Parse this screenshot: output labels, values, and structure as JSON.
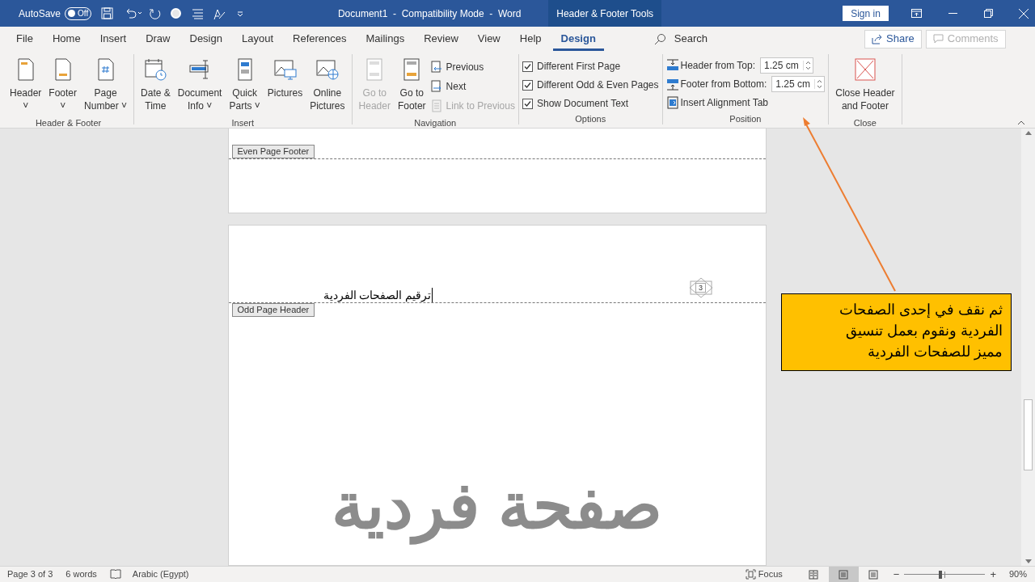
{
  "title_bar": {
    "autosave_label": "AutoSave",
    "autosave_on": false,
    "autosave_state": "Off",
    "document_title": "Document1  -  Compatibility Mode  -  Word",
    "contextual_tab": "Header & Footer Tools",
    "sign_in": "Sign in"
  },
  "menu_tabs": [
    {
      "label": "File",
      "selected": false
    },
    {
      "label": "Home",
      "selected": false
    },
    {
      "label": "Insert",
      "selected": false
    },
    {
      "label": "Draw",
      "selected": false
    },
    {
      "label": "Design",
      "selected": false
    },
    {
      "label": "Layout",
      "selected": false
    },
    {
      "label": "References",
      "selected": false
    },
    {
      "label": "Mailings",
      "selected": false
    },
    {
      "label": "Review",
      "selected": false
    },
    {
      "label": "View",
      "selected": false
    },
    {
      "label": "Help",
      "selected": false
    },
    {
      "label": "Design",
      "selected": true
    }
  ],
  "search": "Search",
  "share": "Share",
  "comments": {
    "label": "Comments",
    "disabled": true
  },
  "ribbon_groups": [
    {
      "name": "Header & Footer",
      "items": [
        {
          "kind": "big",
          "label": "Header\n˅",
          "disabled": false
        },
        {
          "kind": "big",
          "label": "Footer\n˅",
          "disabled": false
        },
        {
          "kind": "big",
          "label": "Page\nNumber ˅",
          "disabled": false
        }
      ]
    },
    {
      "name": "Insert",
      "items": [
        {
          "kind": "big",
          "label": "Date &\nTime",
          "disabled": false
        },
        {
          "kind": "big",
          "label": "Document\nInfo ˅",
          "disabled": false
        },
        {
          "kind": "big",
          "label": "Quick\nParts ˅",
          "disabled": false
        },
        {
          "kind": "big",
          "label": "Pictures",
          "disabled": false
        },
        {
          "kind": "big",
          "label": "Online\nPictures",
          "disabled": false
        }
      ]
    },
    {
      "name": "Navigation",
      "items": [
        {
          "kind": "big",
          "label": "Go to\nHeader",
          "disabled": true
        },
        {
          "kind": "big",
          "label": "Go to\nFooter",
          "disabled": false
        },
        {
          "kind": "stack",
          "entries": [
            {
              "label": "Previous",
              "disabled": false
            },
            {
              "label": "Next",
              "disabled": false
            },
            {
              "label": "Link to Previous",
              "disabled": true
            }
          ]
        }
      ]
    },
    {
      "name": "Options",
      "items": [
        {
          "kind": "checks",
          "entries": [
            {
              "label": "Different First Page",
              "checked": true
            },
            {
              "label": "Different Odd & Even Pages",
              "checked": true
            },
            {
              "label": "Show Document Text",
              "checked": true
            }
          ]
        }
      ]
    },
    {
      "name": "Position",
      "items": [
        {
          "kind": "position",
          "entries": [
            {
              "label": "Header from Top:",
              "value": "1.25 cm"
            },
            {
              "label": "Footer from Bottom:",
              "value": "1.25 cm"
            },
            {
              "label": "Insert Alignment Tab"
            }
          ]
        }
      ]
    },
    {
      "name": "Close",
      "items": [
        {
          "kind": "big",
          "label": "Close Header\nand Footer",
          "disabled": false
        }
      ]
    }
  ],
  "document": {
    "even_footer_tag": "Even Page Footer",
    "odd_header_tag": "Odd Page Header",
    "header_text": "ترقيم الصفحات الفردية",
    "page_number": "3",
    "body_text": "صفحة فردية"
  },
  "callout": {
    "text": "ثم نقف في إحدى الصفحات الفردية ونقوم بعمل تنسيق مميز للصفحات الفردية"
  },
  "status_bar": {
    "page": "Page 3 of 3",
    "words": "6 words",
    "language": "Arabic (Egypt)",
    "focus": "Focus",
    "views": [
      {
        "selected": false
      },
      {
        "selected": true
      },
      {
        "selected": false
      }
    ],
    "zoom_minus": "−",
    "zoom_plus": "+",
    "zoom": {
      "level": 0.45
    },
    "zoom_label": "90%"
  }
}
